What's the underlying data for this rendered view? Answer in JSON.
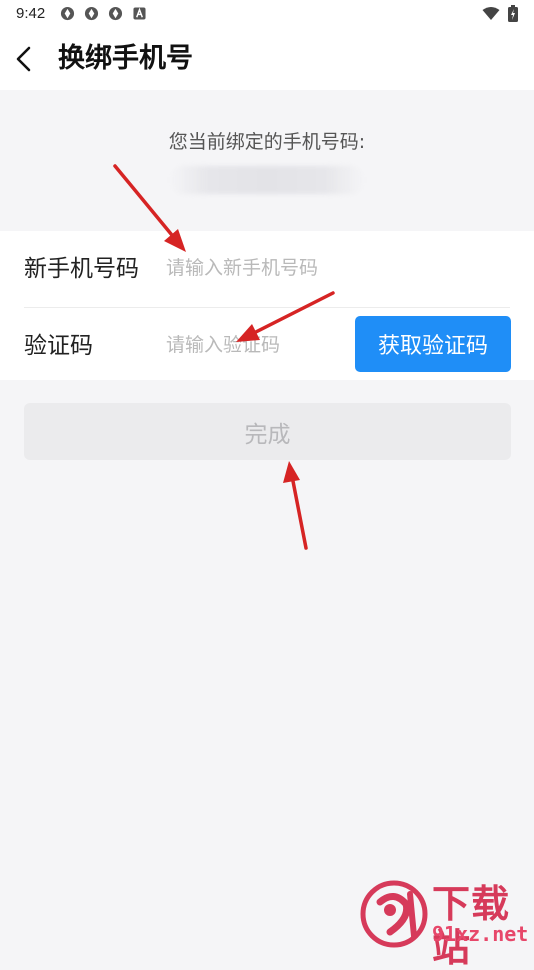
{
  "status_bar": {
    "time": "9:42"
  },
  "header": {
    "title": "换绑手机号"
  },
  "current_phone": {
    "label": "您当前绑定的手机号码:"
  },
  "form": {
    "new_phone_label": "新手机号码",
    "new_phone_placeholder": "请输入新手机号码",
    "new_phone_value": "",
    "code_label": "验证码",
    "code_placeholder": "请输入验证码",
    "code_value": "",
    "get_code_button": "获取验证码"
  },
  "actions": {
    "done_button": "完成"
  },
  "watermark": {
    "title": "下载站",
    "domain": "91xz.net"
  },
  "colors": {
    "accent": "#1f8ef7",
    "disabled_button": "#ebebed",
    "page_background": "#f5f5f7",
    "annotation_arrow": "#d62424"
  }
}
